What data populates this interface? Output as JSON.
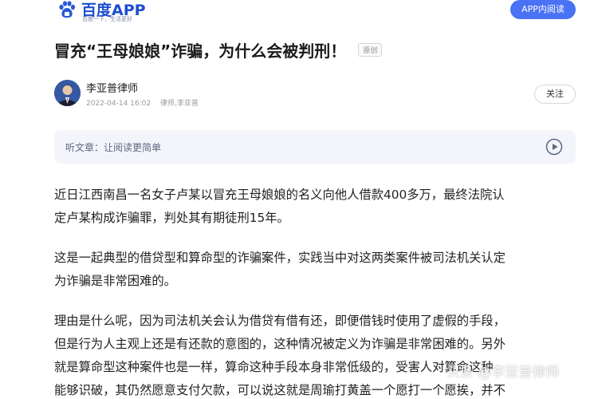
{
  "header": {
    "logo_title": "百度APP",
    "logo_slogan": "百度一下，生活更好",
    "open_app_label": "APP内阅读"
  },
  "article": {
    "title": "冒充“王母娘娘”诈骗，为什么会被判刑！",
    "original_badge": "原创",
    "author_name": "李亚普律师",
    "publish_time": "2022-04-14 16:02",
    "author_desc": "律师,李亚普",
    "follow_label": "关注",
    "listen_label": "听文章：让阅读更简单",
    "paragraphs": [
      [
        "近日江西南昌一名女子卢某以冒充王母娘娘的名义向他人借款400多万，最终法院认",
        "定卢某构成诈骗罪，判处其有期徒刑15年。"
      ],
      [
        "这是一起典型的借贷型和算命型的诈骗案件，实践当中对这两类案件被司法机关认定",
        "为诈骗是非常困难的。"
      ],
      [
        "理由是什么呢，因为司法机关会认为借贷有借有还，即便借钱时使用了虚假的手段，",
        "但是行为人主观上还是有还款的意图的，这种情况被定义为诈骗是非常困难的。另外",
        "就是算命型这种案件也是一样，算命这种手段本身非常低级的，受害人对算命这种",
        "能够识破，其仍然愿意支付欠款，可以说这就是周瑜打黄盖一个愿打一个愿挨，并不"
      ]
    ],
    "watermark": "头条 @李亚普律师"
  },
  "colors": {
    "brand_blue": "#1e4ecf",
    "button_blue": "#4a72f5",
    "listen_bg": "#f3f5fb"
  }
}
